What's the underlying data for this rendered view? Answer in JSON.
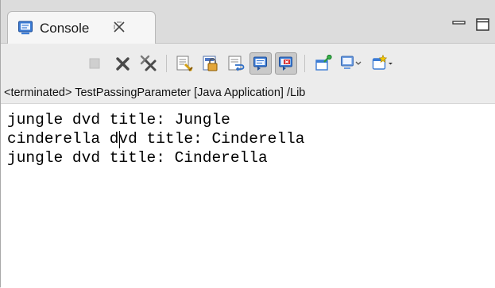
{
  "tab": {
    "label": "Console",
    "icon": "console-icon",
    "close_icon": "close-icon"
  },
  "window_controls": {
    "minimize_icon": "minimize-icon",
    "maximize_icon": "maximize-icon"
  },
  "toolbar": {
    "buttons": [
      {
        "name": "terminate-button",
        "icon": "stop-icon",
        "enabled": false
      },
      {
        "name": "remove-launch-button",
        "icon": "remove-x-icon",
        "enabled": true
      },
      {
        "name": "remove-all-terminated-button",
        "icon": "remove-all-icon",
        "enabled": true
      },
      {
        "name": "clear-console-button",
        "icon": "clear-console-icon",
        "enabled": true
      },
      {
        "name": "scroll-lock-button",
        "icon": "scroll-lock-icon",
        "enabled": true
      },
      {
        "name": "word-wrap-button",
        "icon": "word-wrap-icon",
        "enabled": true
      },
      {
        "name": "show-console-stdout-button",
        "icon": "show-stdout-icon",
        "pressed": true
      },
      {
        "name": "show-console-stderr-button",
        "icon": "show-stderr-icon",
        "pressed": true
      },
      {
        "name": "pin-console-button",
        "icon": "pin-icon",
        "enabled": true
      },
      {
        "name": "display-selected-console-button",
        "icon": "display-console-icon",
        "enabled": true
      },
      {
        "name": "open-console-button",
        "icon": "new-console-icon",
        "enabled": true
      }
    ]
  },
  "description": "<terminated> TestPassingParameter [Java Application] /Lib",
  "output": {
    "lines": [
      "jungle dvd title: Jungle",
      "cinderella dvd title: Cinderella",
      "jungle dvd title: Cinderella"
    ]
  },
  "colors": {
    "tab_background": "#f6f6f6",
    "console_background": "#ffffff",
    "toolbar_background": "#ececec",
    "text": "#000000"
  }
}
